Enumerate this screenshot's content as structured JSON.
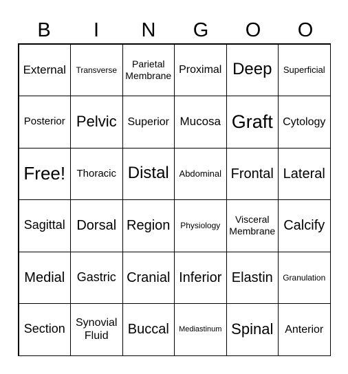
{
  "header": [
    "B",
    "I",
    "N",
    "G",
    "O",
    "O"
  ],
  "cells": [
    [
      "External",
      "Transverse",
      "Parietal Membrane",
      "Proximal",
      "Deep",
      "Superficial"
    ],
    [
      "Posterior",
      "Pelvic",
      "Superior",
      "Mucosa",
      "Graft",
      "Cytology"
    ],
    [
      "Free!",
      "Thoracic",
      "Distal",
      "Abdominal",
      "Frontal",
      "Lateral"
    ],
    [
      "Sagittal",
      "Dorsal",
      "Region",
      "Physiology",
      "Visceral Membrane",
      "Calcify"
    ],
    [
      "Medial",
      "Gastric",
      "Cranial",
      "Inferior",
      "Elastin",
      "Granulation"
    ],
    [
      "Section",
      "Synovial Fluid",
      "Buccal",
      "Mediastinum",
      "Spinal",
      "Anterior"
    ]
  ]
}
